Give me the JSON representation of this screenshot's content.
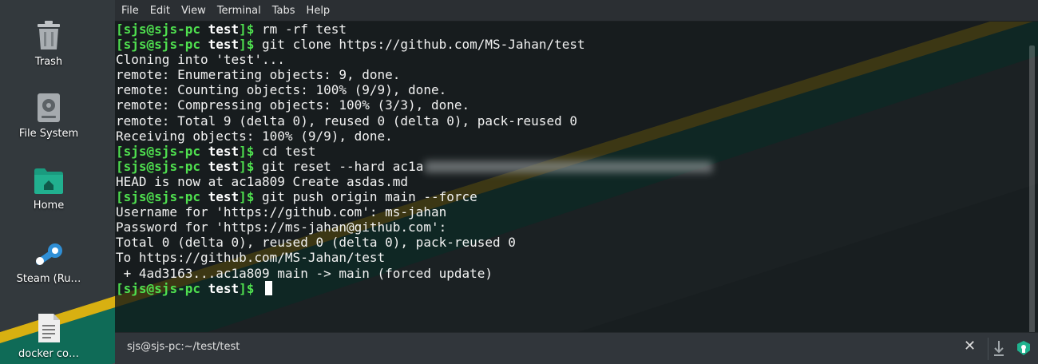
{
  "desktop": {
    "icons": [
      {
        "label": "Trash",
        "icon": "trash-icon"
      },
      {
        "label": "File System",
        "icon": "harddisk-icon"
      },
      {
        "label": "Home",
        "icon": "home-folder-icon"
      },
      {
        "label": "Steam (Ru…",
        "icon": "steam-icon"
      },
      {
        "label": "docker co…",
        "icon": "text-file-icon"
      }
    ]
  },
  "terminal": {
    "menu": [
      "File",
      "Edit",
      "View",
      "Terminal",
      "Tabs",
      "Help"
    ],
    "prompt": {
      "open": "[",
      "user_host": "sjs@sjs-pc",
      "dir": "test",
      "close": "]$"
    },
    "lines": [
      {
        "type": "prompt",
        "cmd": " rm -rf test"
      },
      {
        "type": "prompt",
        "cmd": " git clone https://github.com/MS-Jahan/test"
      },
      {
        "type": "out",
        "text": "Cloning into 'test'..."
      },
      {
        "type": "out",
        "text": "remote: Enumerating objects: 9, done."
      },
      {
        "type": "out",
        "text": "remote: Counting objects: 100% (9/9), done."
      },
      {
        "type": "out",
        "text": "remote: Compressing objects: 100% (3/3), done."
      },
      {
        "type": "out",
        "text": "remote: Total 9 (delta 0), reused 0 (delta 0), pack-reused 0"
      },
      {
        "type": "out",
        "text": "Receiving objects: 100% (9/9), done."
      },
      {
        "type": "prompt",
        "cmd": " cd test"
      },
      {
        "type": "prompt",
        "cmd": " git reset --hard ac1a"
      },
      {
        "type": "out",
        "text": "HEAD is now at ac1a809 Create asdas.md"
      },
      {
        "type": "prompt",
        "cmd": " git push origin main --force"
      },
      {
        "type": "out",
        "text": "Username for 'https://github.com': ms-jahan"
      },
      {
        "type": "out",
        "text": "Password for 'https://ms-jahan@github.com':"
      },
      {
        "type": "out",
        "text": "Total 0 (delta 0), reused 0 (delta 0), pack-reused 0"
      },
      {
        "type": "out",
        "text": "To https://github.com/MS-Jahan/test"
      },
      {
        "type": "out",
        "text": " + 4ad3163...ac1a809 main -> main (forced update)"
      },
      {
        "type": "prompt",
        "cmd": " "
      }
    ],
    "tab_title": "sjs@sjs-pc:~/test/test",
    "close_glyph": "✕",
    "colors": {
      "prompt": "#4fe04f",
      "text": "#f2f2f2"
    }
  }
}
